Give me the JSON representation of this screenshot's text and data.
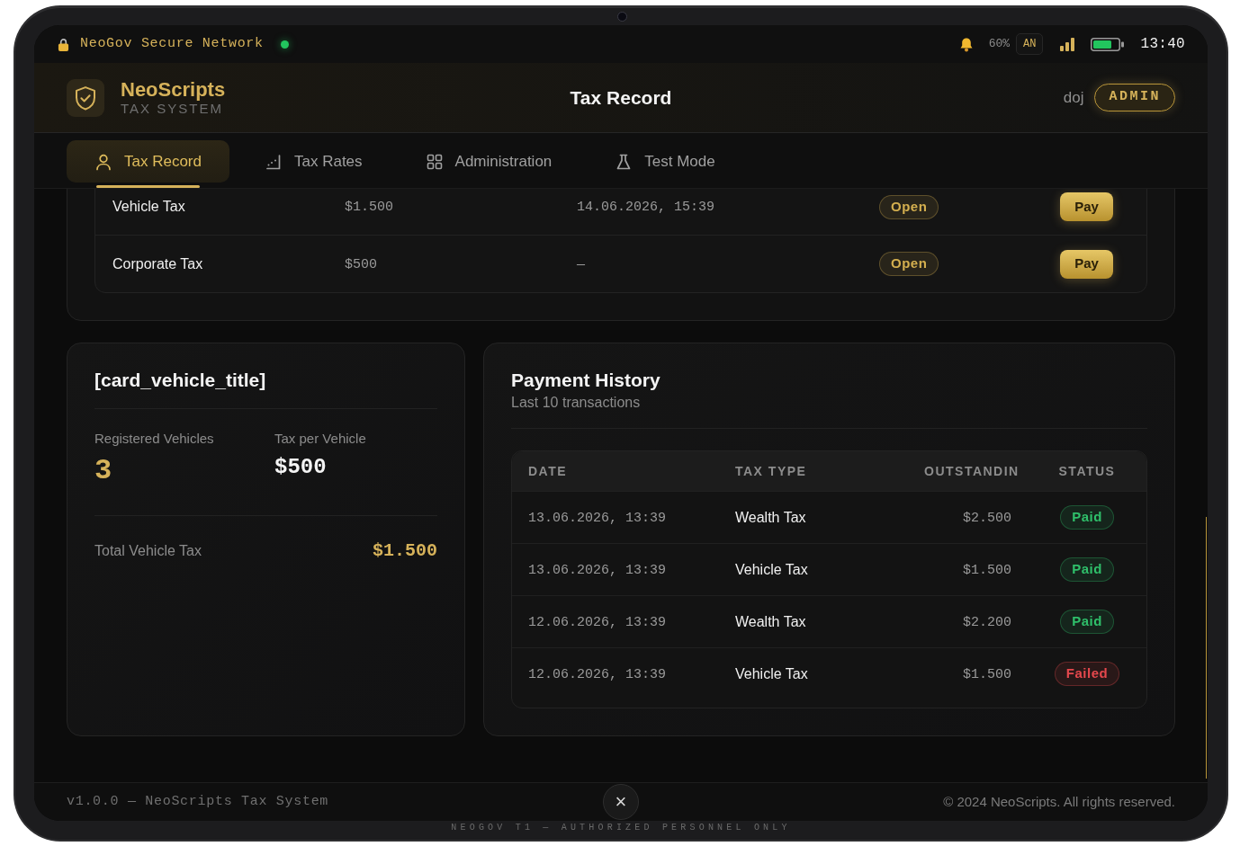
{
  "status_bar": {
    "network": "NeoGov Secure Network",
    "connected": true,
    "battery_percent": "60%",
    "user_initials": "AN",
    "time": "13:40"
  },
  "header": {
    "brand": "NeoScripts",
    "subtitle": "TAX SYSTEM",
    "title": "Tax Record",
    "user": "doj",
    "role": "ADMIN"
  },
  "tabs": [
    {
      "label": "Tax Record",
      "selected": true
    },
    {
      "label": "Tax Rates",
      "selected": false
    },
    {
      "label": "Administration",
      "selected": false
    },
    {
      "label": "Test Mode",
      "selected": false
    }
  ],
  "open_taxes": {
    "rows": [
      {
        "tax_type": "Vehicle Tax",
        "amount": "$1.500",
        "due": "14.06.2026, 15:39",
        "status": "Open",
        "color": "#d4af4f",
        "action": "Pay"
      },
      {
        "tax_type": "Corporate Tax",
        "amount": "$500",
        "due": "—",
        "status": "Open",
        "color": "#d4af4f",
        "action": "Pay"
      }
    ]
  },
  "vehicle_card": {
    "title": "[card_vehicle_title]",
    "registered_label": "Registered Vehicles",
    "registered_value": "3",
    "rate_label": "Tax per Vehicle",
    "rate_value": "$500",
    "total_label": "Total Vehicle Tax",
    "total_value": "$1.500"
  },
  "payment_history": {
    "title": "Payment History",
    "subtitle": "Last 10 transactions",
    "columns": [
      "DATE",
      "TAX TYPE",
      "OUTSTANDIN",
      "STATUS"
    ],
    "rows": [
      {
        "date": "13.06.2026, 13:39",
        "tax_type": "Wealth Tax",
        "amount": "$2.500",
        "status": "Paid",
        "color": "#2fbf6a"
      },
      {
        "date": "13.06.2026, 13:39",
        "tax_type": "Vehicle Tax",
        "amount": "$1.500",
        "status": "Paid",
        "color": "#2fbf6a"
      },
      {
        "date": "12.06.2026, 13:39",
        "tax_type": "Wealth Tax",
        "amount": "$2.200",
        "status": "Paid",
        "color": "#2fbf6a"
      },
      {
        "date": "12.06.2026, 13:39",
        "tax_type": "Vehicle Tax",
        "amount": "$1.500",
        "status": "Failed",
        "color": "#e5484d"
      }
    ]
  },
  "footer": {
    "version": "v1.0.0 — NeoScripts Tax System",
    "close_label": "×",
    "copyright": "© 2024 NeoScripts. All rights reserved."
  },
  "device_label": "NEOGOV T1 — AUTHORIZED PERSONNEL ONLY"
}
